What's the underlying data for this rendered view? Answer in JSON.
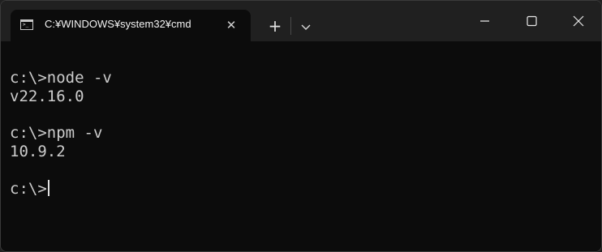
{
  "window": {
    "tab_title": "C:¥WINDOWS¥system32¥cmd",
    "tab_close_symbol": "✕",
    "new_tab_symbol": "+"
  },
  "icons": {
    "tab": "cmd-icon",
    "tab_close": "close-icon",
    "new_tab": "plus-icon",
    "dropdown": "chevron-down-icon",
    "minimize": "minimize-icon",
    "maximize": "maximize-icon",
    "close": "close-icon"
  },
  "terminal": {
    "lines": [
      "c:\\>node -v",
      "v22.16.0",
      "",
      "c:\\>npm -v",
      "10.9.2",
      "",
      "c:\\>"
    ]
  },
  "colors": {
    "terminal_bg": "#0c0c0c",
    "titlebar_bg": "#202020",
    "text": "#cccccc"
  }
}
